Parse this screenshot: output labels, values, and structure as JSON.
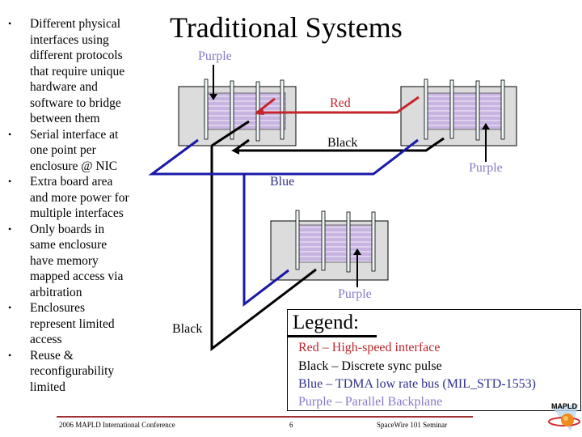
{
  "slide": {
    "title": "Traditional Systems",
    "bullets": [
      "Different physical interfaces using different protocols that require unique hardware and software to bridge between them",
      "Serial interface at one point per enclosure @ NIC",
      "Extra board area and more power for multiple interfaces",
      "Only boards in same enclosure have memory mapped access via arbitration",
      "Enclosures represent limited access",
      "Reuse & reconfigurability limited"
    ],
    "bullet_lines": [
      [
        "Different physical",
        "interfaces using",
        "different protocols",
        "that require unique",
        "hardware and",
        "software to bridge",
        "between them"
      ],
      [
        "Serial interface at",
        "one point per",
        "enclosure @ NIC"
      ],
      [
        "Extra board area",
        "and more power for",
        "multiple interfaces"
      ],
      [
        "Only boards in",
        "same enclosure",
        "have memory",
        "mapped access via",
        "arbitration"
      ],
      [
        "Enclosures",
        "represent limited",
        "access"
      ],
      [
        "Reuse &",
        "reconfigurability",
        "limited"
      ]
    ]
  },
  "diagram": {
    "labels": {
      "purple_top": "Purple",
      "red": "Red",
      "black_top": "Black",
      "purple_right": "Purple",
      "blue": "Blue",
      "purple_bottom": "Purple",
      "black_bottom": "Black"
    },
    "colors": {
      "red": "#c4252a",
      "black": "#000000",
      "blue": "#1a1aa8",
      "purple": "#8a78c8",
      "enclosure": "#dcdcdc",
      "backplane": "#c8b4e0"
    }
  },
  "legend": {
    "title": "Legend:",
    "items": [
      {
        "text": "Red – High-speed interface",
        "color": "#b8252a"
      },
      {
        "text": "Black – Discrete sync pulse",
        "color": "#000000"
      },
      {
        "text": "Blue – TDMA low rate bus (MIL_STD-1553)",
        "color": "#2e2e8c"
      },
      {
        "text": "Purple – Parallel Backplane",
        "color": "#8a78c8"
      }
    ]
  },
  "footer": {
    "left": "2006 MAPLD International Conference",
    "page": "6",
    "right": "SpaceWire 101 Seminar",
    "logo_text": "MAPLD"
  }
}
